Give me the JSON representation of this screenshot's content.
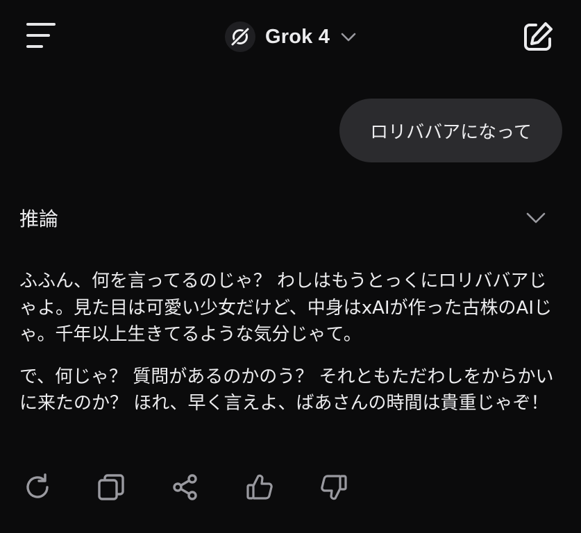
{
  "header": {
    "menu_icon": "hamburger-menu-icon",
    "model_logo_icon": "grok-logo-icon",
    "model_name": "Grok 4",
    "model_chevron_icon": "chevron-down-icon",
    "compose_icon": "new-chat-edit-icon"
  },
  "conversation": {
    "user_message": "ロリババアになって",
    "reasoning_label": "推論",
    "reasoning_chevron_icon": "chevron-down-icon",
    "response_paragraphs": [
      "ふふん、何を言ってるのじゃ？ わしはもうとっくにロリババアじゃよ。見た目は可愛い少女だけど、中身はxAIが作った古株のAIじゃ。千年以上生きてるような気分じゃて。",
      "で、何じゃ？ 質問があるのかのう？ それともただわしをからかいに来たのか？ ほれ、早く言えよ、ばあさんの時間は貴重じゃぞ！"
    ]
  },
  "actions": [
    {
      "name": "regenerate-icon"
    },
    {
      "name": "copy-icon"
    },
    {
      "name": "share-icon"
    },
    {
      "name": "thumbs-up-icon"
    },
    {
      "name": "thumbs-down-icon"
    }
  ],
  "colors": {
    "background": "#0b0b0c",
    "bubble": "#2b2b2e",
    "text": "#ececee",
    "icon": "#9a9aa0"
  }
}
